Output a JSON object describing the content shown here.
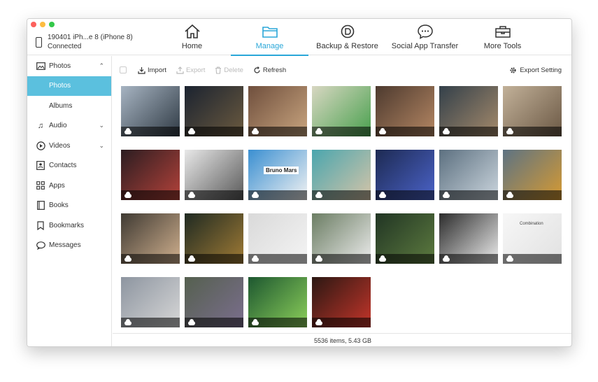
{
  "device": {
    "name": "190401 iPh...e 8 (iPhone 8)",
    "status": "Connected"
  },
  "nav": [
    {
      "label": "Home",
      "icon": "home-icon"
    },
    {
      "label": "Manage",
      "icon": "folder-icon",
      "active": true
    },
    {
      "label": "Backup & Restore",
      "icon": "backup-icon"
    },
    {
      "label": "Social App Transfer",
      "icon": "chat-icon"
    },
    {
      "label": "More Tools",
      "icon": "toolbox-icon"
    }
  ],
  "sidebar": {
    "items": [
      {
        "label": "Photos",
        "icon": "photo-icon",
        "expanded": true
      },
      {
        "label": "Photos",
        "sub": true,
        "selected": true
      },
      {
        "label": "Albums",
        "sub": true
      },
      {
        "label": "Audio",
        "icon": "music-icon"
      },
      {
        "label": "Videos",
        "icon": "play-icon"
      },
      {
        "label": "Contacts",
        "icon": "contacts-icon"
      },
      {
        "label": "Apps",
        "icon": "apps-icon"
      },
      {
        "label": "Books",
        "icon": "book-icon"
      },
      {
        "label": "Bookmarks",
        "icon": "bookmark-icon"
      },
      {
        "label": "Messages",
        "icon": "message-icon"
      }
    ]
  },
  "toolbar": {
    "import_label": "Import",
    "export_label": "Export",
    "delete_label": "Delete",
    "refresh_label": "Refresh",
    "export_setting_label": "Export Setting"
  },
  "grid_text": {
    "bruno": "Bruno Mars",
    "combination": "Combination"
  },
  "photo_colors": [
    [
      "#a7b4c2",
      "#2f3a44"
    ],
    [
      "#1b2330",
      "#6b5a3f"
    ],
    [
      "#6f4f3d",
      "#c9a57f"
    ],
    [
      "#d8d7c2",
      "#48a04d"
    ],
    [
      "#4d3a2f",
      "#b58763"
    ],
    [
      "#33404a",
      "#a58a6b"
    ],
    [
      "#c2b199",
      "#6b5844"
    ],
    [
      "#2b1d21",
      "#b4423a"
    ],
    [
      "#e8e8e8",
      "#595959"
    ],
    [
      "#3a8fd1",
      "#f2f2f2"
    ],
    [
      "#4aa6ae",
      "#d5c4a8"
    ],
    [
      "#1d2a52",
      "#4b63c9"
    ],
    [
      "#5c7080",
      "#ccd6de"
    ],
    [
      "#5d7383",
      "#d69a32"
    ],
    [
      "#3f3a33",
      "#d0b08e"
    ],
    [
      "#1f2a22",
      "#a07b35"
    ],
    [
      "#d9d9d9",
      "#f4f4f4"
    ],
    [
      "#6b7d63",
      "#ececec"
    ],
    [
      "#213524",
      "#5d7b3f"
    ],
    [
      "#2c2c2c",
      "#ededed"
    ],
    [
      "#f7f7f7",
      "#e1e1e1"
    ],
    [
      "#8d95a0",
      "#d7d7d7"
    ],
    [
      "#55604f",
      "#7b6e8e"
    ],
    [
      "#1d5730",
      "#8ccf5a"
    ],
    [
      "#2b1813",
      "#c4352a"
    ]
  ],
  "footer": {
    "summary": "5536 items, 5.43 GB"
  }
}
